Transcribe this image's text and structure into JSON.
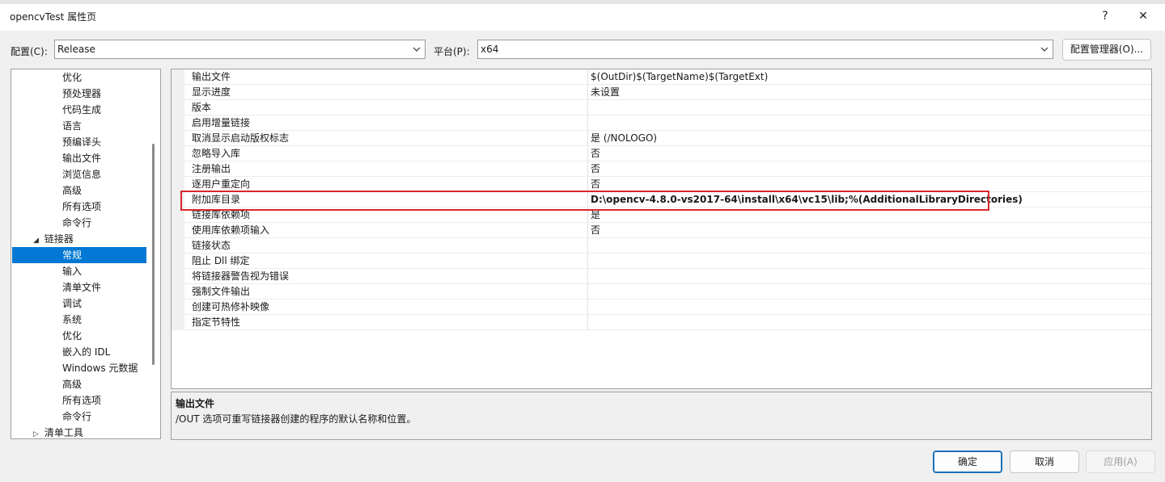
{
  "window": {
    "title": "opencvTest 属性页",
    "help_glyph": "?",
    "close_glyph": "✕"
  },
  "config_bar": {
    "config_label": "配置(C):",
    "config_value": "Release",
    "platform_label": "平台(P):",
    "platform_value": "x64",
    "manager_button": "配置管理器(O)..."
  },
  "tree": {
    "items": [
      {
        "label": "优化"
      },
      {
        "label": "预处理器"
      },
      {
        "label": "代码生成"
      },
      {
        "label": "语言"
      },
      {
        "label": "预编译头"
      },
      {
        "label": "输出文件"
      },
      {
        "label": "浏览信息"
      },
      {
        "label": "高级"
      },
      {
        "label": "所有选项"
      },
      {
        "label": "命令行"
      },
      {
        "label": "链接器"
      },
      {
        "label": "常规"
      },
      {
        "label": "输入"
      },
      {
        "label": "清单文件"
      },
      {
        "label": "调试"
      },
      {
        "label": "系统"
      },
      {
        "label": "优化"
      },
      {
        "label": "嵌入的 IDL"
      },
      {
        "label": "Windows 元数据"
      },
      {
        "label": "高级"
      },
      {
        "label": "所有选项"
      },
      {
        "label": "命令行"
      },
      {
        "label": "清单工具"
      }
    ]
  },
  "grid": {
    "rows": [
      {
        "name": "输出文件",
        "value": "$(OutDir)$(TargetName)$(TargetExt)"
      },
      {
        "name": "显示进度",
        "value": "未设置"
      },
      {
        "name": "版本",
        "value": ""
      },
      {
        "name": "启用增量链接",
        "value": ""
      },
      {
        "name": "取消显示启动版权标志",
        "value": "是 (/NOLOGO)"
      },
      {
        "name": "忽略导入库",
        "value": "否"
      },
      {
        "name": "注册输出",
        "value": "否"
      },
      {
        "name": "逐用户重定向",
        "value": "否"
      },
      {
        "name": "附加库目录",
        "value": "D:\\opencv-4.8.0-vs2017-64\\install\\x64\\vc15\\lib;%(AdditionalLibraryDirectories)"
      },
      {
        "name": "链接库依赖项",
        "value": "是"
      },
      {
        "name": "使用库依赖项输入",
        "value": "否"
      },
      {
        "name": "链接状态",
        "value": ""
      },
      {
        "name": "阻止 Dll 绑定",
        "value": ""
      },
      {
        "name": "将链接器警告视为错误",
        "value": ""
      },
      {
        "name": "强制文件输出",
        "value": ""
      },
      {
        "name": "创建可热修补映像",
        "value": ""
      },
      {
        "name": "指定节特性",
        "value": ""
      }
    ]
  },
  "description": {
    "title": "输出文件",
    "text": "/OUT 选项可重写链接器创建的程序的默认名称和位置。"
  },
  "footer": {
    "ok": "确定",
    "cancel": "取消",
    "apply": "应用(A)"
  }
}
